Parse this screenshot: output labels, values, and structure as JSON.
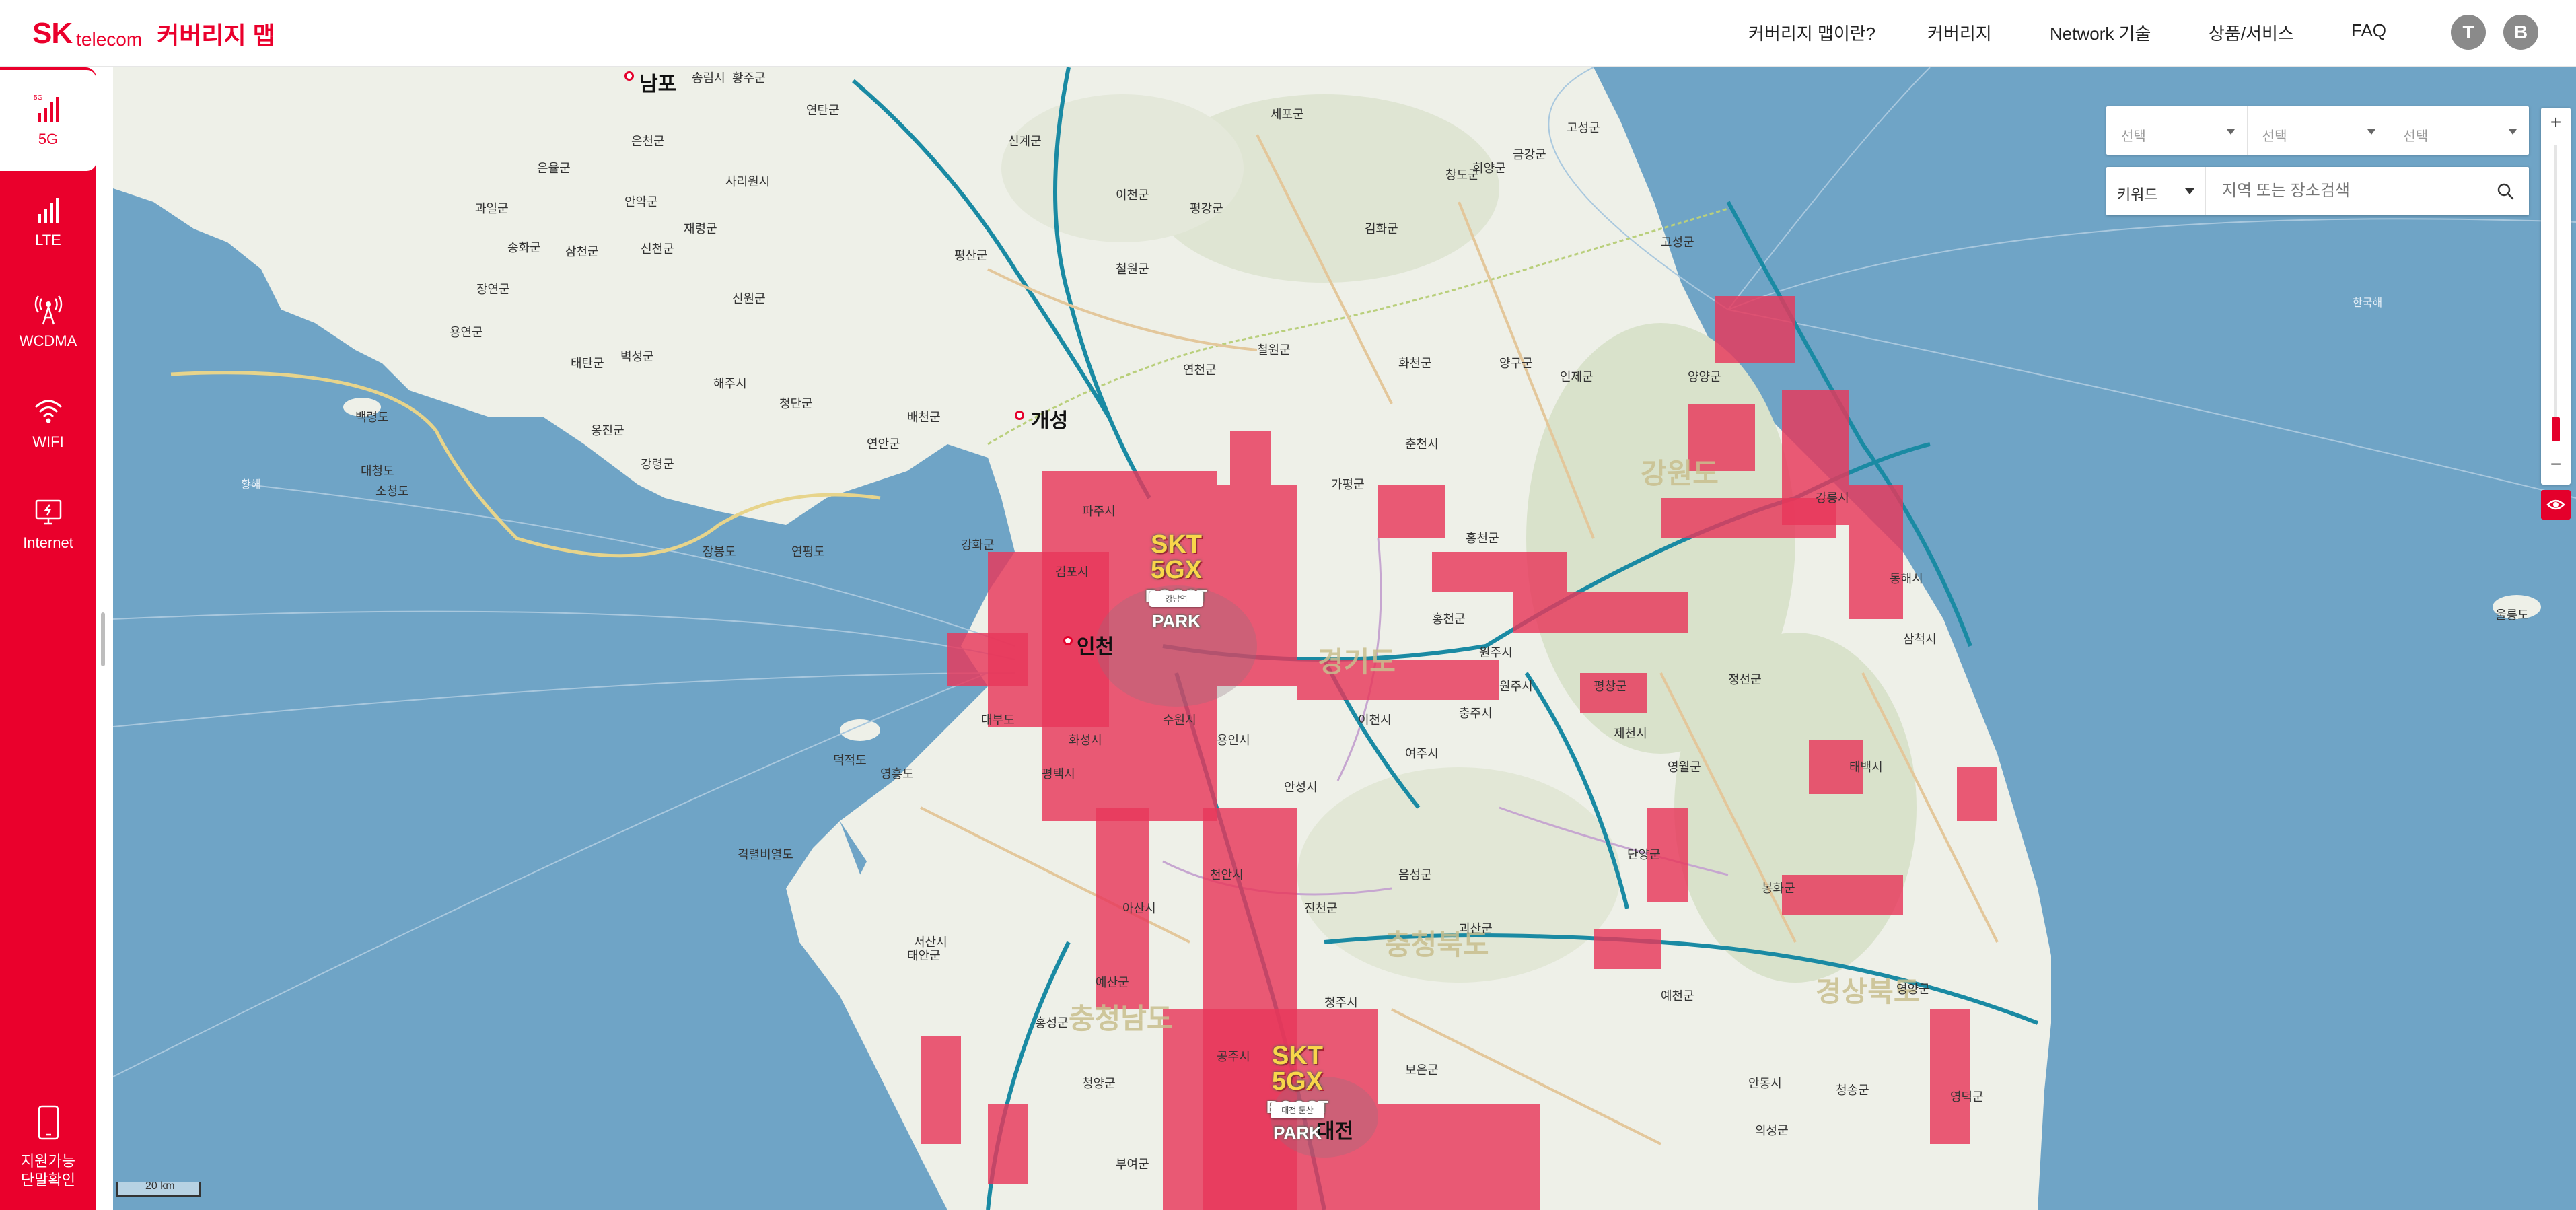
{
  "header": {
    "brand_sk": "SK",
    "brand_telecom": "telecom",
    "app_title": "커버리지 맵",
    "nav": [
      {
        "label": "커버리지 맵이란?"
      },
      {
        "label": "커버리지"
      },
      {
        "label": "Network 기술"
      },
      {
        "label": "상품/서비스"
      },
      {
        "label": "FAQ"
      }
    ],
    "btn_t": "T",
    "btn_b": "B"
  },
  "sidebar": {
    "tabs": [
      {
        "label": "5G",
        "small": "5G",
        "active": true
      },
      {
        "label": "LTE"
      },
      {
        "label": "WCDMA"
      },
      {
        "label": "WIFI"
      },
      {
        "label": "Internet"
      }
    ],
    "devices_line1": "지원가능",
    "devices_line2": "단말확인"
  },
  "filters": {
    "select1": "선택",
    "select2": "선택",
    "select3": "선택",
    "keyword": "키워드",
    "search_placeholder": "지역 또는 장소검색"
  },
  "zoom": {
    "plus": "+",
    "minus": "−"
  },
  "map": {
    "scale": "20 km",
    "major_cities": [
      {
        "name": "남포"
      },
      {
        "name": "개성"
      },
      {
        "name": "인천"
      },
      {
        "name": "대전"
      }
    ],
    "provinces": [
      {
        "name": "강원도"
      },
      {
        "name": "경기도"
      },
      {
        "name": "충청북도"
      },
      {
        "name": "충청남도"
      },
      {
        "name": "경상북도"
      }
    ],
    "labels": [
      {
        "name": "송림시"
      },
      {
        "name": "황주군"
      },
      {
        "name": "연탄군"
      },
      {
        "name": "은천군"
      },
      {
        "name": "은율군"
      },
      {
        "name": "안악군"
      },
      {
        "name": "재령군"
      },
      {
        "name": "사리원시"
      },
      {
        "name": "과일군"
      },
      {
        "name": "송화군"
      },
      {
        "name": "삼천군"
      },
      {
        "name": "신천군"
      },
      {
        "name": "신원군"
      },
      {
        "name": "장연군"
      },
      {
        "name": "용연군"
      },
      {
        "name": "태탄군"
      },
      {
        "name": "벽성군"
      },
      {
        "name": "해주시"
      },
      {
        "name": "청단군"
      },
      {
        "name": "배천군"
      },
      {
        "name": "연안군"
      },
      {
        "name": "강령군"
      },
      {
        "name": "옹진군"
      },
      {
        "name": "백령도"
      },
      {
        "name": "대청도"
      },
      {
        "name": "소청도"
      },
      {
        "name": "평산군"
      },
      {
        "name": "신계군"
      },
      {
        "name": "이천군"
      },
      {
        "name": "평강군"
      },
      {
        "name": "철원군"
      },
      {
        "name": "김화군"
      },
      {
        "name": "세포군"
      },
      {
        "name": "회양군"
      },
      {
        "name": "창도군"
      },
      {
        "name": "금강군"
      },
      {
        "name": "고성군"
      },
      {
        "name": "연천군"
      },
      {
        "name": "철원군"
      },
      {
        "name": "화천군"
      },
      {
        "name": "양구군"
      },
      {
        "name": "인제군"
      },
      {
        "name": "고성군"
      },
      {
        "name": "춘천시"
      },
      {
        "name": "홍천군"
      },
      {
        "name": "가평군"
      },
      {
        "name": "양양군"
      },
      {
        "name": "강릉시"
      },
      {
        "name": "평창군"
      },
      {
        "name": "정선군"
      },
      {
        "name": "영월군"
      },
      {
        "name": "태백시"
      },
      {
        "name": "삼척시"
      },
      {
        "name": "동해시"
      },
      {
        "name": "단양군"
      },
      {
        "name": "봉화군"
      },
      {
        "name": "영양군"
      },
      {
        "name": "영덕군"
      },
      {
        "name": "예천군"
      },
      {
        "name": "안동시"
      },
      {
        "name": "의성군"
      },
      {
        "name": "청송군"
      },
      {
        "name": "충주시"
      },
      {
        "name": "제천시"
      },
      {
        "name": "원주시"
      },
      {
        "name": "음성군"
      },
      {
        "name": "괴산군"
      },
      {
        "name": "진천군"
      },
      {
        "name": "청주시"
      },
      {
        "name": "보은군"
      },
      {
        "name": "천안시"
      },
      {
        "name": "아산시"
      },
      {
        "name": "예산군"
      },
      {
        "name": "홍성군"
      },
      {
        "name": "서산시"
      },
      {
        "name": "태안군"
      },
      {
        "name": "청양군"
      },
      {
        "name": "공주시"
      },
      {
        "name": "부여군"
      },
      {
        "name": "강화군"
      },
      {
        "name": "김포시"
      },
      {
        "name": "파주시"
      },
      {
        "name": "수원시"
      },
      {
        "name": "용인시"
      },
      {
        "name": "이천시"
      },
      {
        "name": "여주시"
      },
      {
        "name": "안성시"
      },
      {
        "name": "평택시"
      },
      {
        "name": "화성시"
      },
      {
        "name": "울릉도"
      },
      {
        "name": "한국해"
      },
      {
        "name": "황해"
      },
      {
        "name": "연평도"
      },
      {
        "name": "덕적도"
      },
      {
        "name": "영흥도"
      },
      {
        "name": "장봉도"
      },
      {
        "name": "격렬비열도"
      },
      {
        "name": "홍천군"
      },
      {
        "name": "원주시"
      },
      {
        "name": "대부도"
      }
    ],
    "parks": [
      {
        "title": "SKT 5GX",
        "sub": "BOOST PARK",
        "tag": "강남역"
      },
      {
        "title": "SKT 5GX",
        "sub": "BOOST PARK",
        "tag": "대전 둔산"
      }
    ]
  },
  "colors": {
    "brand": "#ea002c",
    "coverage": "#e8375a",
    "sea": "#6fa4c6",
    "land": "#eef0e8"
  }
}
